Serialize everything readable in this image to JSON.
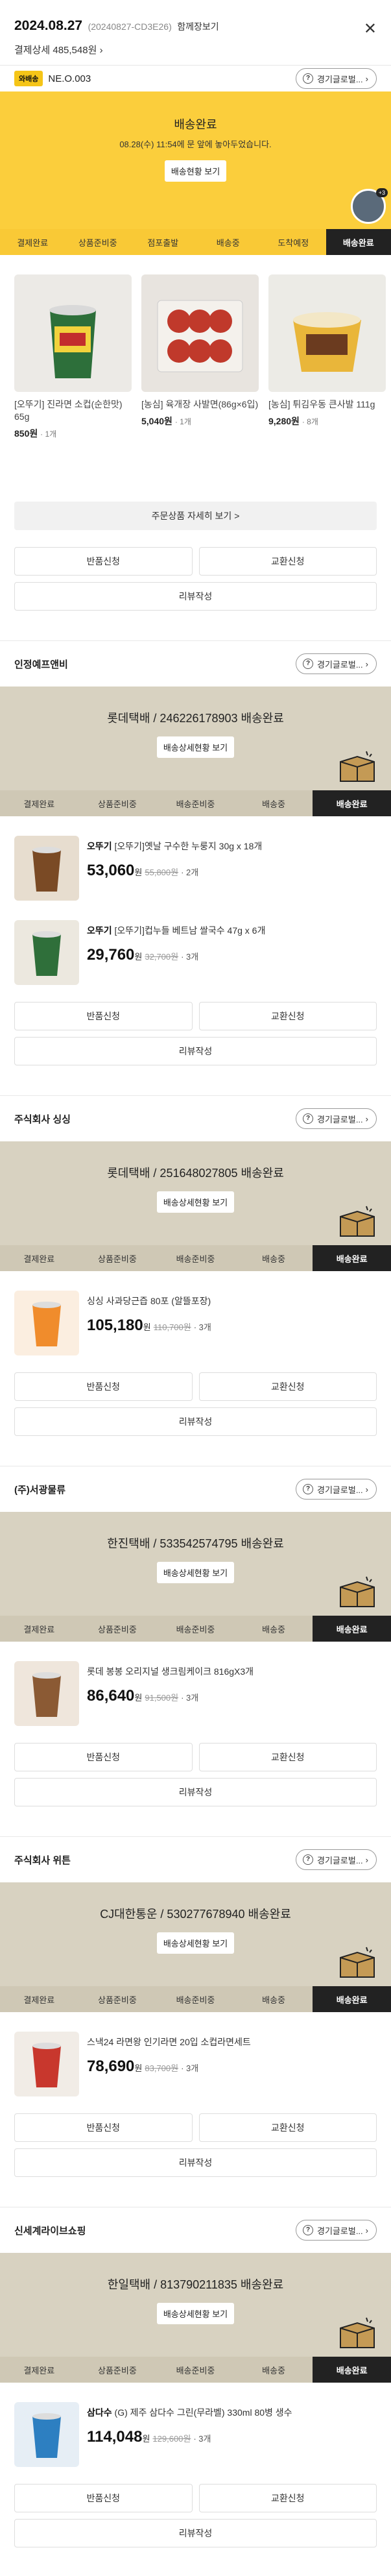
{
  "header": {
    "date": "2024.08.27",
    "order_no": "(20240827-CD3E26)",
    "together": "함께장보기",
    "payment": "결제상세 485,548원",
    "close": "✕"
  },
  "seller_badge": "와배송",
  "seller_badge_name": "NE.O.003",
  "inquiry_label": "경기글로벌...",
  "yellow_banner": {
    "title": "배송완료",
    "desc": "08.28(수) 11:54에 문 앞에 놓아두었습니다.",
    "button": "배송현황 보기",
    "avatar_badge": "+3"
  },
  "steps": [
    "결제완료",
    "상품준비중",
    "점포출발",
    "배송중",
    "도착예정",
    "배송완료"
  ],
  "steps_b": [
    "결제완료",
    "상품준비중",
    "배송준비중",
    "배송중",
    "배송완료"
  ],
  "products": [
    {
      "name": "[오뚜기] 진라면 소컵(순한맛) 65g",
      "price": "850원",
      "qty": "· 1개"
    },
    {
      "name": "[농심] 육개장 사발면(86g×6입)",
      "price": "5,040원",
      "qty": "· 1개"
    },
    {
      "name": "[농심] 튀김우동 큰사발 111g",
      "price": "9,280원",
      "qty": "· 8개"
    }
  ],
  "detail_button": "주문상품 자세히 보기 >",
  "buttons": {
    "return": "반품신청",
    "exchange": "교환신청",
    "review": "리뷰작성"
  },
  "sections": [
    {
      "seller": "인정예프앤비",
      "banner": "롯데택배 / 246226178903 배송완료",
      "banner_btn": "배송상세현황 보기",
      "items": [
        {
          "brand": "오뚜기",
          "name": "[오뚜기]옛날 구수한 누룽지 30g x 18개",
          "price": "53,060",
          "orig": "55,800원",
          "cnt": "· 2개"
        },
        {
          "brand": "오뚜기",
          "name": "[오뚜기]컵누들 베트남 쌀국수 47g x 6개",
          "price": "29,760",
          "orig": "32,700원",
          "cnt": "· 3개"
        }
      ]
    },
    {
      "seller": "주식회사 싱싱",
      "banner": "롯데택배 / 251648027805 배송완료",
      "banner_btn": "배송상세현황 보기",
      "items": [
        {
          "brand": "",
          "name": "싱싱 사과당근즙 80포 (알뜰포장)",
          "price": "105,180",
          "orig": "110,700원",
          "cnt": "· 3개"
        }
      ]
    },
    {
      "seller": "(주)서광물류",
      "banner": "한진택배 / 533542574795 배송완료",
      "banner_btn": "배송상세현황 보기",
      "items": [
        {
          "brand": "",
          "name": "롯데 봉봉 오리지널 생크림케이크 816gX3개",
          "price": "86,640",
          "orig": "91,500원",
          "cnt": "· 3개"
        }
      ]
    },
    {
      "seller": "주식회사 위튼",
      "banner": "CJ대한통운 / 530277678940 배송완료",
      "banner_btn": "배송상세현황 보기",
      "items": [
        {
          "brand": "",
          "name": "스낵24 라면왕 인기라면 20입 소컵라면세트",
          "price": "78,690",
          "orig": "83,700원",
          "cnt": "· 3개"
        }
      ]
    },
    {
      "seller": "신세계라이브쇼핑",
      "banner": "한일택배 / 813790211835 배송완료",
      "banner_btn": "배송상세현황 보기",
      "items": [
        {
          "brand": "삼다수",
          "name": "(G) 제주 삼다수 그린(무라벨) 330ml 80병 생수",
          "price": "114,048",
          "orig": "129,600원",
          "cnt": "· 3개"
        }
      ]
    }
  ],
  "currency": "원",
  "colors": {
    "yellow": "#fbce3c",
    "beige": "#d8d2c1",
    "dark": "#222222"
  }
}
